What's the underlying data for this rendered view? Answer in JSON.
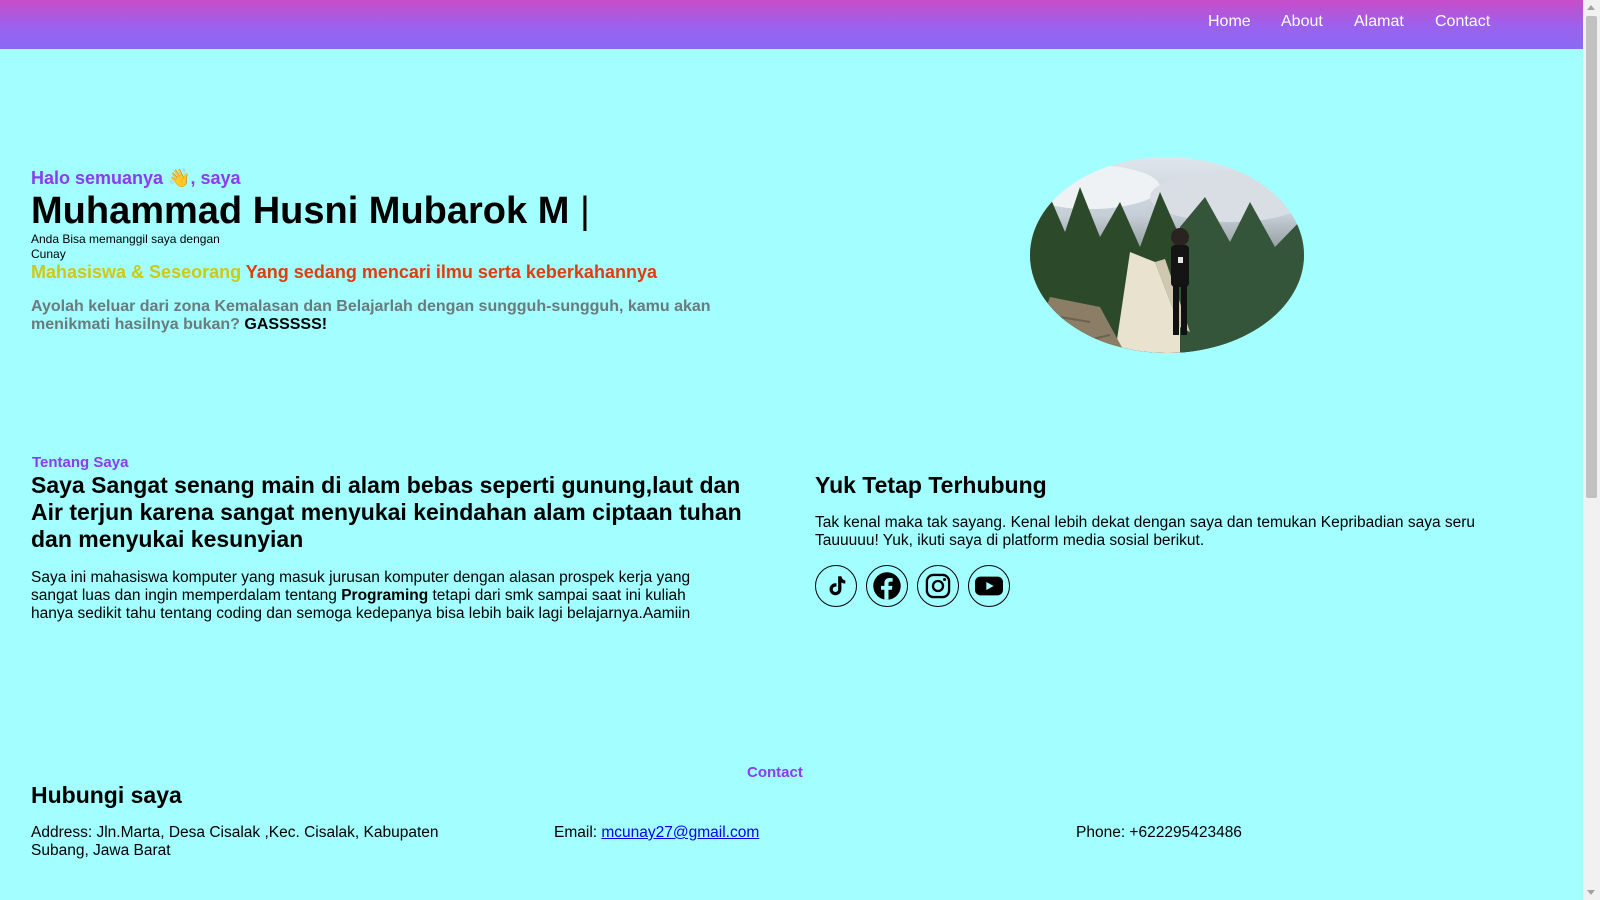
{
  "nav": {
    "items": [
      {
        "label": "Home"
      },
      {
        "label": "About"
      },
      {
        "label": "Alamat"
      },
      {
        "label": "Contact"
      }
    ]
  },
  "hero": {
    "greeting": "Halo semuanya 👋, saya",
    "name": "Muhammad Husni Mubarok M",
    "cursor": "|",
    "subtitle_line1": "Anda Bisa memanggil saya dengan",
    "subtitle_line2": "Cunay",
    "role_highlight": "Mahasiswa & Seseorang",
    "role_rest": "Yang sedang mencari ilmu serta keberkahannya",
    "motto_text": "Ayolah keluar dari zona Kemalasan dan Belajarlah dengan sungguh-sungguh, kamu akan menikmati hasilnya bukan?",
    "motto_emphasis": "GASSSSS!"
  },
  "about": {
    "tag": "Tentang Saya",
    "heading": "Saya Sangat senang main di alam bebas seperti gunung,laut dan Air terjun karena sangat menyukai keindahan alam ciptaan tuhan dan menyukai kesunyian",
    "body_part1": "Saya ini mahasiswa komputer yang masuk jurusan komputer dengan alasan prospek kerja yang sangat luas dan ingin memperdalam tentang",
    "body_bold": "Programing",
    "body_part2": "tetapi dari smk sampai saat ini kuliah hanya sedikit tahu tentang coding dan semoga kedepanya bisa lebih baik lagi belajarnya.Aamiin"
  },
  "connect": {
    "heading": "Yuk Tetap Terhubung",
    "body": "Tak kenal maka tak sayang. Kenal lebih dekat dengan saya dan temukan Kepribadian saya seru Tauuuuu! Yuk, ikuti saya di platform media sosial berikut.",
    "socials": [
      "tiktok-icon",
      "facebook-icon",
      "instagram-icon",
      "youtube-icon"
    ]
  },
  "contact": {
    "tag": "Contact",
    "heading": "Hubungi saya",
    "address": "Address: Jln.Marta, Desa Cisalak ,Kec. Cisalak, Kabupaten Subang, Jawa Barat",
    "email_label": "Email:",
    "email": "mcunay27@gmail.com",
    "phone": "Phone: +622295423486"
  },
  "colors": {
    "background": "#a3ffff",
    "accent_purple": "#8a3cf0",
    "role_yellow": "#cfc814",
    "role_red": "#e03c10"
  }
}
